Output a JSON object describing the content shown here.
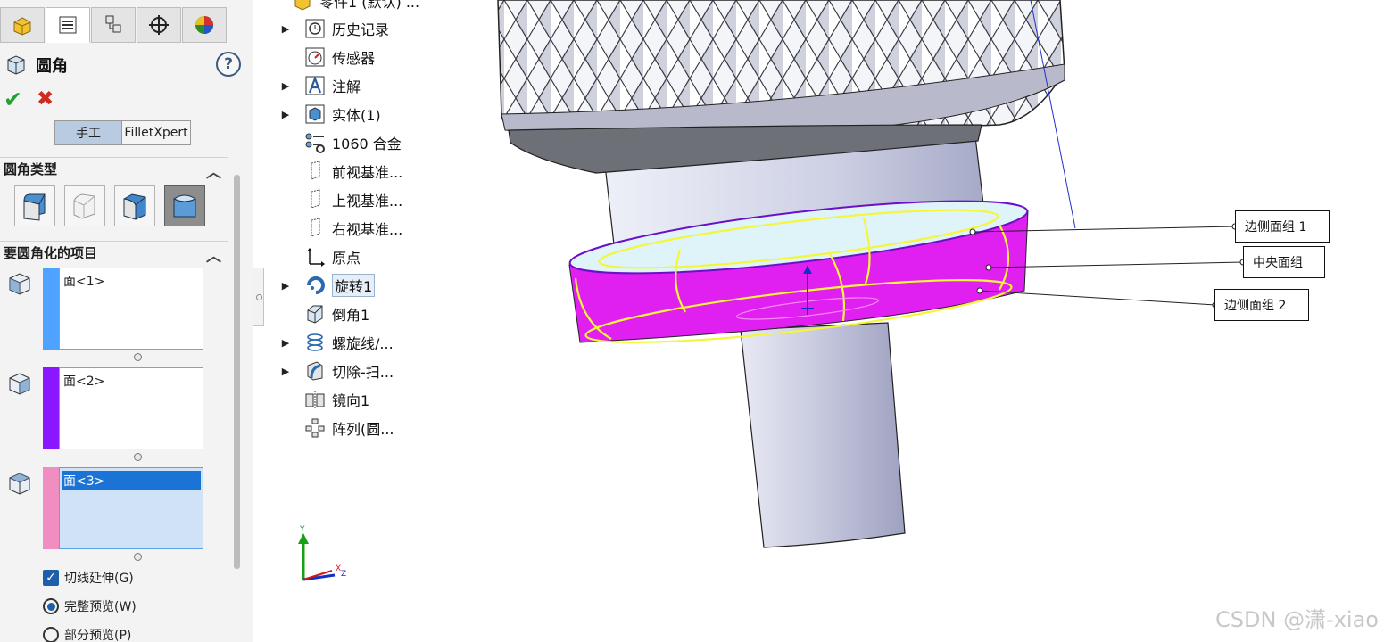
{
  "property_manager": {
    "tabs": [
      "feature-manager-icon",
      "property-manager-icon",
      "configuration-manager-icon",
      "dimxpert-icon",
      "display-manager-icon"
    ],
    "title": "圆角",
    "help_label": "?",
    "ok_label": "✔",
    "cancel_label": "✖",
    "modes": [
      {
        "label": "手工",
        "active": true
      },
      {
        "label": "FilletXpert",
        "active": false
      }
    ],
    "fillet_type": {
      "header": "圆角类型",
      "options": [
        "constant-size-fillet-icon",
        "variable-size-fillet-icon",
        "face-fillet-icon",
        "full-round-fillet-icon"
      ],
      "selected_index": 3
    },
    "items_to_fillet": {
      "header": "要圆角化的项目",
      "faces": [
        {
          "label": "面<1>",
          "color": "#4da3ff",
          "selected": false
        },
        {
          "label": "面<2>",
          "color": "#8a17ff",
          "selected": false
        },
        {
          "label": "面<3>",
          "color": "#f08ec2",
          "selected": true
        }
      ]
    },
    "options": {
      "tangent_propagation": {
        "label": "切线延伸(G)",
        "checked": true
      },
      "full_preview": {
        "label": "完整预览(W)",
        "selected": true
      },
      "partial_preview": {
        "label": "部分预览(P)",
        "selected": false
      }
    }
  },
  "feature_tree": {
    "root_label": "零件1 (默认) ...",
    "nodes": [
      {
        "label": "历史记录",
        "icon": "history-icon",
        "expandable": true
      },
      {
        "label": "传感器",
        "icon": "sensor-icon",
        "expandable": false
      },
      {
        "label": "注解",
        "icon": "annotation-icon",
        "expandable": true
      },
      {
        "label": "实体(1)",
        "icon": "solid-body-icon",
        "expandable": true
      },
      {
        "label": "1060 合金",
        "icon": "material-icon",
        "expandable": false
      },
      {
        "label": "前视基准...",
        "icon": "plane-icon",
        "expandable": false
      },
      {
        "label": "上视基准...",
        "icon": "plane-icon",
        "expandable": false
      },
      {
        "label": "右视基准...",
        "icon": "plane-icon",
        "expandable": false
      },
      {
        "label": "原点",
        "icon": "origin-icon",
        "expandable": false
      },
      {
        "label": "旋转1",
        "icon": "revolve-icon",
        "expandable": true,
        "highlighted": true
      },
      {
        "label": "倒角1",
        "icon": "chamfer-icon",
        "expandable": false
      },
      {
        "label": "螺旋线/...",
        "icon": "helix-icon",
        "expandable": true
      },
      {
        "label": "切除-扫...",
        "icon": "swept-cut-icon",
        "expandable": true
      },
      {
        "label": "镜向1",
        "icon": "mirror-icon",
        "expandable": false
      },
      {
        "label": "阵列(圆...",
        "icon": "circular-pattern-icon",
        "expandable": false
      }
    ]
  },
  "viewport": {
    "callouts": [
      {
        "label": "边侧面组 1"
      },
      {
        "label": "中央面组"
      },
      {
        "label": "边侧面组 2"
      }
    ],
    "triad_labels": {
      "y": "Y",
      "x": "X",
      "z": "Z"
    },
    "watermark": "CSDN @潇-xiao",
    "colors": {
      "highlight_magenta": "#e020f0",
      "selection_yellow": "#f5f53a",
      "body_gray": "#c9cbe0"
    }
  }
}
